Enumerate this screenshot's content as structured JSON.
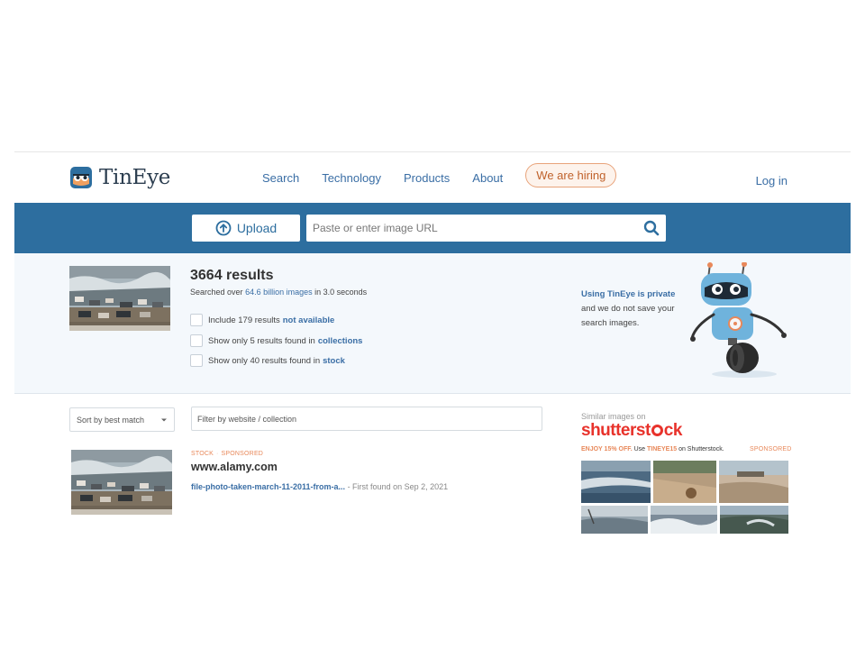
{
  "header": {
    "logo_text": "TinEye",
    "nav": [
      "Search",
      "Technology",
      "Products",
      "About"
    ],
    "hiring": "We are hiring",
    "login": "Log in"
  },
  "searchbar": {
    "upload_label": "Upload",
    "url_placeholder": "Paste or enter image URL"
  },
  "summary": {
    "results_count": "3664 results",
    "searched_prefix": "Searched over",
    "searched_highlight": "64.6 billion images",
    "searched_suffix": "in 3.0 seconds",
    "filters": [
      {
        "text": "Include 179 results",
        "link": "not available"
      },
      {
        "text": "Show only 5 results found in",
        "link": "collections"
      },
      {
        "text": "Show only 40 results found in",
        "link": "stock"
      }
    ],
    "privacy_link": "Using TinEye is private",
    "privacy_line2": "and we do not save your",
    "privacy_line3": "search images."
  },
  "controls": {
    "sort_value": "Sort by best match",
    "site_filter_placeholder": "Filter by website / collection"
  },
  "result": {
    "tag1": "STOCK",
    "tag2": "SPONSORED",
    "domain": "www.alamy.com",
    "file_link": "file-photo-taken-march-11-2011-from-a...",
    "found": "- First found on Sep 2, 2021"
  },
  "shutterstock": {
    "similar_label": "Similar images on",
    "brand_part1": "shutterst",
    "brand_part2": "ck",
    "promo_prefix": "ENJOY 15% OFF.",
    "promo_use": "Use",
    "promo_code": "TINEYE15",
    "promo_suffix": "on Shutterstock.",
    "sponsored": "SPONSORED"
  },
  "colors": {
    "brand_blue": "#2d6e9f",
    "link_blue": "#3a6ea5",
    "accent_orange": "#e8885a",
    "shutterstock_red": "#e8322b"
  }
}
